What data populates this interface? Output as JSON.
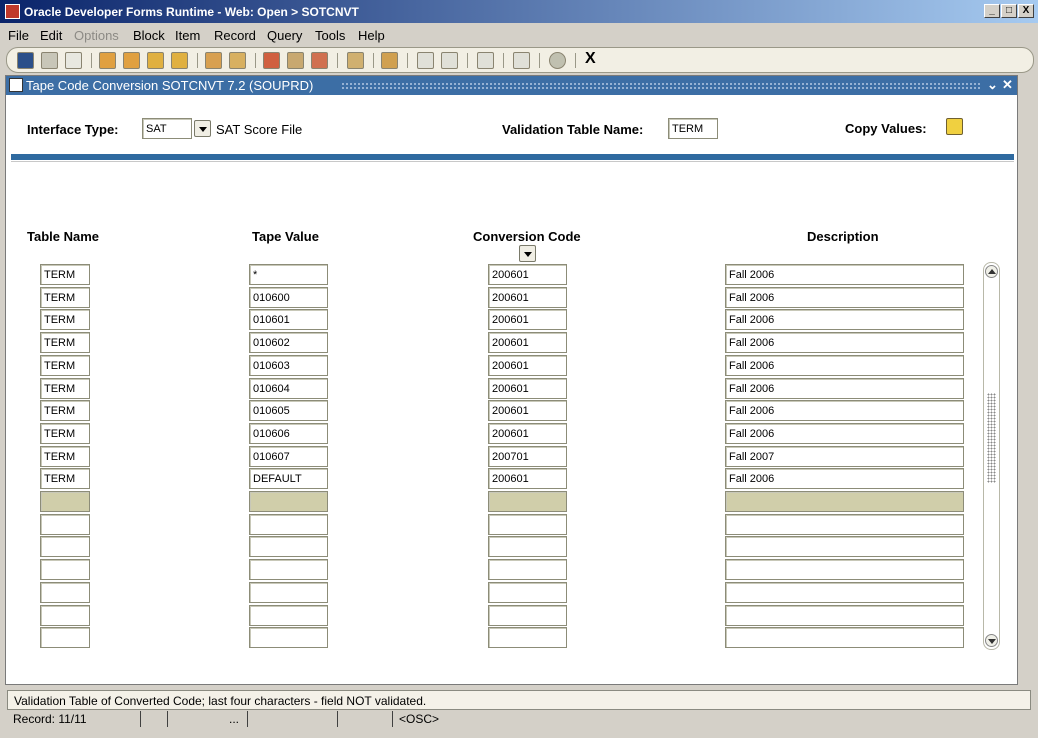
{
  "window": {
    "title": "Oracle Developer Forms Runtime - Web:  Open > SOTCNVT",
    "min": "_",
    "max": "□",
    "close": "X"
  },
  "menu": [
    "File",
    "Edit",
    "Options",
    "Block",
    "Item",
    "Record",
    "Query",
    "Tools",
    "Help"
  ],
  "toolbar": {
    "exit_label": "X"
  },
  "form": {
    "title": "Tape Code Conversion  SOTCNVT  7.2  (SOUPRD)",
    "interface_type_label": "Interface Type:",
    "interface_type_value": "SAT",
    "interface_type_desc": "SAT Score File",
    "validation_table_label": "Validation Table Name:",
    "validation_table_value": "TERM",
    "copy_values_label": "Copy Values:"
  },
  "columns": {
    "table_name": "Table Name",
    "tape_value": "Tape Value",
    "conversion_code": "Conversion Code",
    "description": "Description"
  },
  "rows": [
    {
      "table_name": "TERM",
      "tape_value": "*",
      "conversion_code": "200601",
      "description": "Fall 2006"
    },
    {
      "table_name": "TERM",
      "tape_value": "010600",
      "conversion_code": "200601",
      "description": "Fall 2006"
    },
    {
      "table_name": "TERM",
      "tape_value": "010601",
      "conversion_code": "200601",
      "description": "Fall 2006"
    },
    {
      "table_name": "TERM",
      "tape_value": "010602",
      "conversion_code": "200601",
      "description": "Fall 2006"
    },
    {
      "table_name": "TERM",
      "tape_value": "010603",
      "conversion_code": "200601",
      "description": "Fall 2006"
    },
    {
      "table_name": "TERM",
      "tape_value": "010604",
      "conversion_code": "200601",
      "description": "Fall 2006"
    },
    {
      "table_name": "TERM",
      "tape_value": "010605",
      "conversion_code": "200601",
      "description": "Fall 2006"
    },
    {
      "table_name": "TERM",
      "tape_value": "010606",
      "conversion_code": "200601",
      "description": "Fall 2006"
    },
    {
      "table_name": "TERM",
      "tape_value": "010607",
      "conversion_code": "200701",
      "description": "Fall 2007"
    },
    {
      "table_name": "TERM",
      "tape_value": "DEFAULT",
      "conversion_code": "200601",
      "description": "Fall 2006"
    },
    {
      "table_name": "",
      "tape_value": "",
      "conversion_code": "",
      "description": ""
    },
    {
      "table_name": "",
      "tape_value": "",
      "conversion_code": "",
      "description": ""
    },
    {
      "table_name": "",
      "tape_value": "",
      "conversion_code": "",
      "description": ""
    },
    {
      "table_name": "",
      "tape_value": "",
      "conversion_code": "",
      "description": ""
    },
    {
      "table_name": "",
      "tape_value": "",
      "conversion_code": "",
      "description": ""
    },
    {
      "table_name": "",
      "tape_value": "",
      "conversion_code": "",
      "description": ""
    },
    {
      "table_name": "",
      "tape_value": "",
      "conversion_code": "",
      "description": ""
    }
  ],
  "current_row_index": 10,
  "status": {
    "hint": "Validation Table of Converted Code; last four characters - field NOT validated.",
    "record": "Record: 11/11",
    "ellipsis": "...",
    "mode": "<OSC>"
  }
}
